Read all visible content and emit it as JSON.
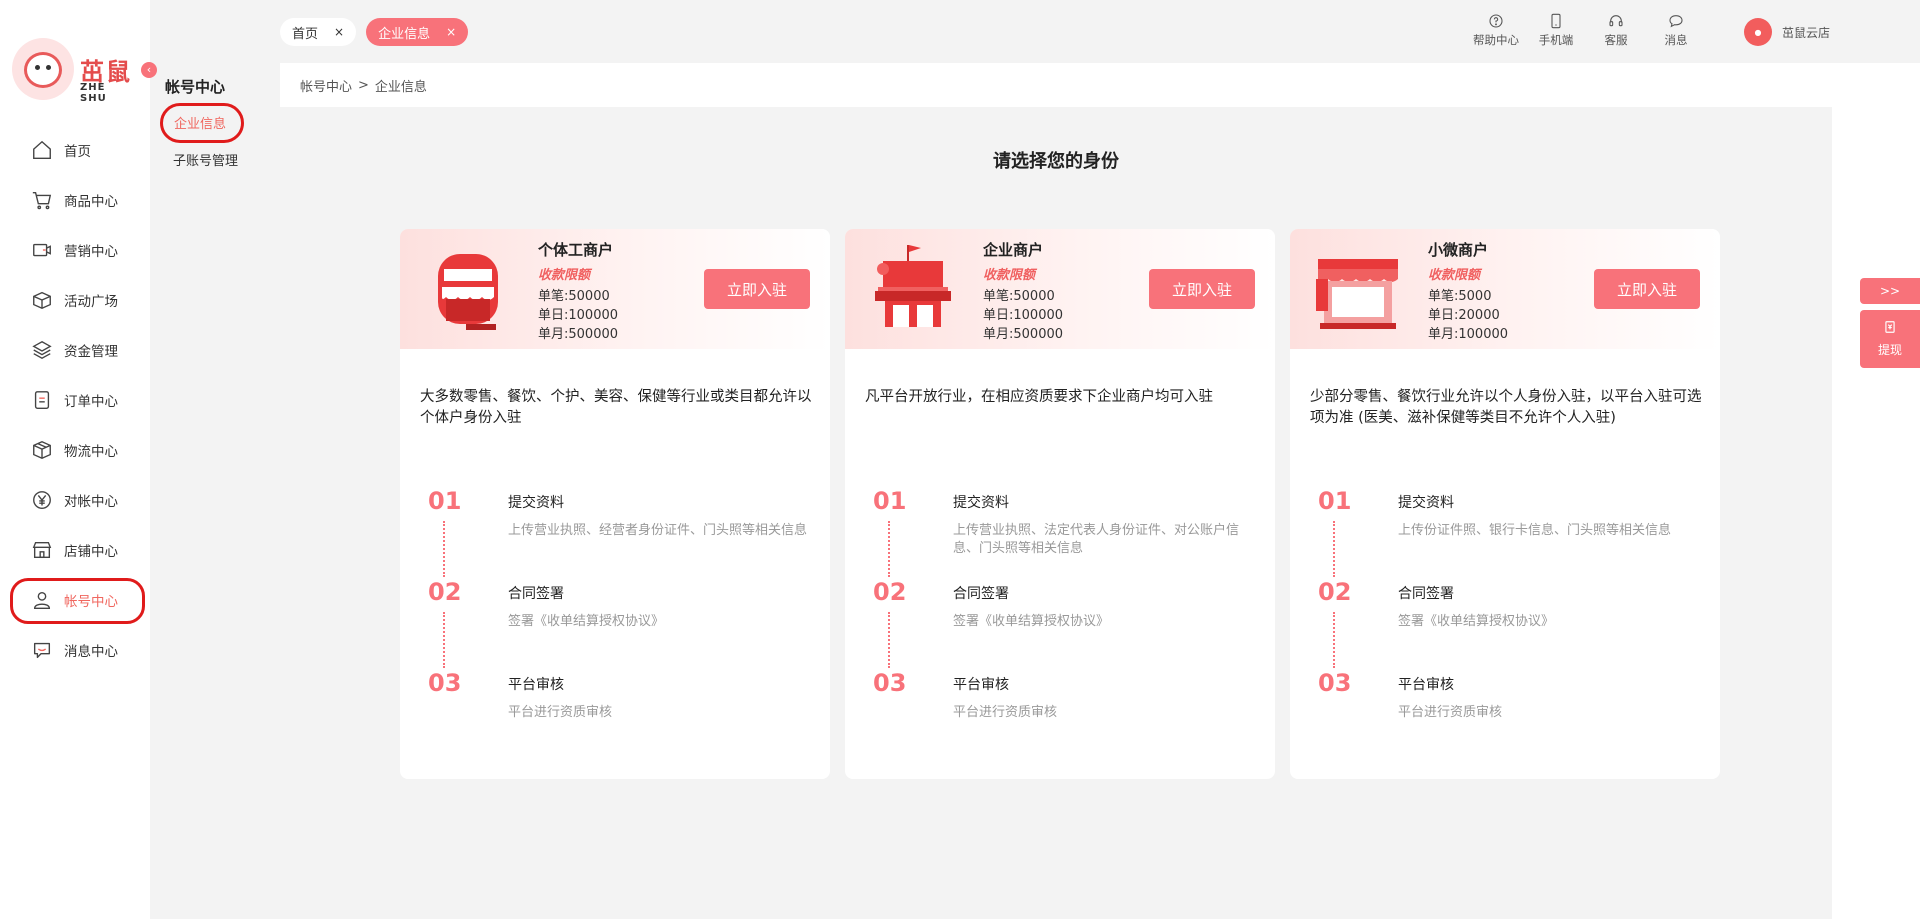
{
  "logo": {
    "text": "茁鼠",
    "sub": "ZHE SHU"
  },
  "nav": {
    "items": [
      {
        "label": "首页",
        "icon": "home-icon"
      },
      {
        "label": "商品中心",
        "icon": "cart-icon"
      },
      {
        "label": "营销中心",
        "icon": "marketing-icon"
      },
      {
        "label": "活动广场",
        "icon": "box-icon"
      },
      {
        "label": "资金管理",
        "icon": "layers-icon"
      },
      {
        "label": "订单中心",
        "icon": "order-icon"
      },
      {
        "label": "物流中心",
        "icon": "package-icon"
      },
      {
        "label": "对帐中心",
        "icon": "yen-icon"
      },
      {
        "label": "店铺中心",
        "icon": "store-icon"
      },
      {
        "label": "帐号中心",
        "icon": "user-icon"
      },
      {
        "label": "消息中心",
        "icon": "message-icon"
      }
    ],
    "active_index": 9
  },
  "subnav": {
    "title": "帐号中心",
    "items": [
      "企业信息",
      "子账号管理"
    ]
  },
  "tabs": [
    {
      "label": "首页",
      "close": "×"
    },
    {
      "label": "企业信息",
      "close": "×"
    }
  ],
  "toolbar": {
    "help": "帮助中心",
    "mobile": "手机端",
    "service": "客服",
    "message": "消息"
  },
  "user": {
    "name": "茁鼠云店"
  },
  "breadcrumb": {
    "parent": "帐号中心",
    "sep": ">",
    "current": "企业信息"
  },
  "main": {
    "title": "请选择您的身份"
  },
  "cards": [
    {
      "name": "个体工商户",
      "limit_label": "收款限额",
      "per_txn": "单笔:50000",
      "per_day": "单日:100000",
      "per_month": "单月:500000",
      "button": "立即入驻",
      "description": "大多数零售、餐饮、个护、美容、保健等行业或类目都允许以个体户身份入驻",
      "steps": [
        {
          "num": "01",
          "title": "提交资料",
          "desc": "上传营业执照、经营者身份证件、门头照等相关信息"
        },
        {
          "num": "02",
          "title": "合同签署",
          "desc": "签署《收单结算授权协议》"
        },
        {
          "num": "03",
          "title": "平台审核",
          "desc": "平台进行资质审核"
        }
      ]
    },
    {
      "name": "企业商户",
      "limit_label": "收款限额",
      "per_txn": "单笔:50000",
      "per_day": "单日:100000",
      "per_month": "单月:500000",
      "button": "立即入驻",
      "description": "凡平台开放行业，在相应资质要求下企业商户均可入驻",
      "steps": [
        {
          "num": "01",
          "title": "提交资料",
          "desc": "上传营业执照、法定代表人身份证件、对公账户信息、门头照等相关信息"
        },
        {
          "num": "02",
          "title": "合同签署",
          "desc": "签署《收单结算授权协议》"
        },
        {
          "num": "03",
          "title": "平台审核",
          "desc": "平台进行资质审核"
        }
      ]
    },
    {
      "name": "小微商户",
      "limit_label": "收款限额",
      "per_txn": "单笔:5000",
      "per_day": "单日:20000",
      "per_month": "单月:100000",
      "button": "立即入驻",
      "description": "少部分零售、餐饮行业允许以个人身份入驻，以平台入驻可选项为准 (医美、滋补保健等类目不允许个人入驻)",
      "steps": [
        {
          "num": "01",
          "title": "提交资料",
          "desc": "上传份证件照、银行卡信息、门头照等相关信息"
        },
        {
          "num": "02",
          "title": "合同签署",
          "desc": "签署《收单结算授权协议》"
        },
        {
          "num": "03",
          "title": "平台审核",
          "desc": "平台进行资质审核"
        }
      ]
    }
  ],
  "float": {
    "expand": ">>",
    "withdraw": "提现"
  },
  "colors": {
    "accent": "#f8727a",
    "highlight_ring": "#e01b1b",
    "active_text": "#f0675f"
  }
}
